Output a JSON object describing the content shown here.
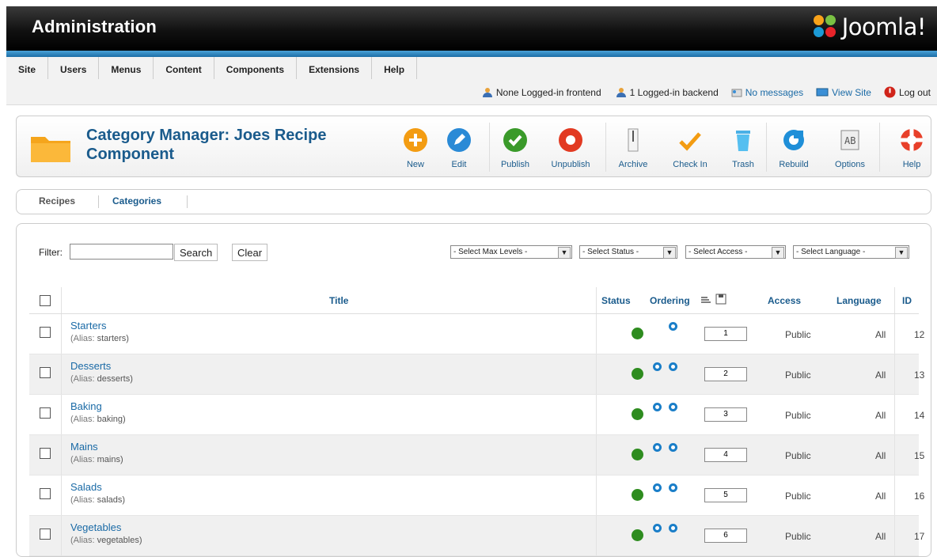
{
  "header": {
    "title": "Administration",
    "logo_text": "Joomla!"
  },
  "menu": [
    "Site",
    "Users",
    "Menus",
    "Content",
    "Components",
    "Extensions",
    "Help"
  ],
  "status": {
    "frontend": "None Logged-in frontend",
    "backend": "1 Logged-in backend",
    "messages": "No messages",
    "view_site": "View Site",
    "logout": "Log out"
  },
  "page_title": "Category Manager: Joes Recipe Component",
  "toolbar": {
    "new": "New",
    "edit": "Edit",
    "publish": "Publish",
    "unpublish": "Unpublish",
    "archive": "Archive",
    "checkin": "Check In",
    "trash": "Trash",
    "rebuild": "Rebuild",
    "options": "Options",
    "help": "Help"
  },
  "submenu": {
    "recipes": "Recipes",
    "categories": "Categories"
  },
  "filter": {
    "label": "Filter:",
    "value": "",
    "search": "Search",
    "clear": "Clear",
    "max_levels": "- Select Max Levels -",
    "status": "- Select Status -",
    "access": "- Select Access -",
    "language": "- Select Language -"
  },
  "table": {
    "headers": {
      "title": "Title",
      "status": "Status",
      "ordering": "Ordering",
      "access": "Access",
      "language": "Language",
      "id": "ID"
    },
    "rows": [
      {
        "title": "Starters",
        "alias_label": "(Alias:",
        "alias": "starters)",
        "order": "1",
        "access": "Public",
        "language": "All",
        "id": "12"
      },
      {
        "title": "Desserts",
        "alias_label": "(Alias:",
        "alias": "desserts)",
        "order": "2",
        "access": "Public",
        "language": "All",
        "id": "13"
      },
      {
        "title": "Baking",
        "alias_label": "(Alias:",
        "alias": "baking)",
        "order": "3",
        "access": "Public",
        "language": "All",
        "id": "14"
      },
      {
        "title": "Mains",
        "alias_label": "(Alias:",
        "alias": "mains)",
        "order": "4",
        "access": "Public",
        "language": "All",
        "id": "15"
      },
      {
        "title": "Salads",
        "alias_label": "(Alias:",
        "alias": "salads)",
        "order": "5",
        "access": "Public",
        "language": "All",
        "id": "16"
      },
      {
        "title": "Vegetables",
        "alias_label": "(Alias:",
        "alias": "vegetables)",
        "order": "6",
        "access": "Public",
        "language": "All",
        "id": "17"
      }
    ]
  },
  "colors": {
    "link": "#1a6aa6",
    "heading": "#1a5b8c",
    "published": "#2e8c1f",
    "accent_bar": "#2a86c4"
  }
}
